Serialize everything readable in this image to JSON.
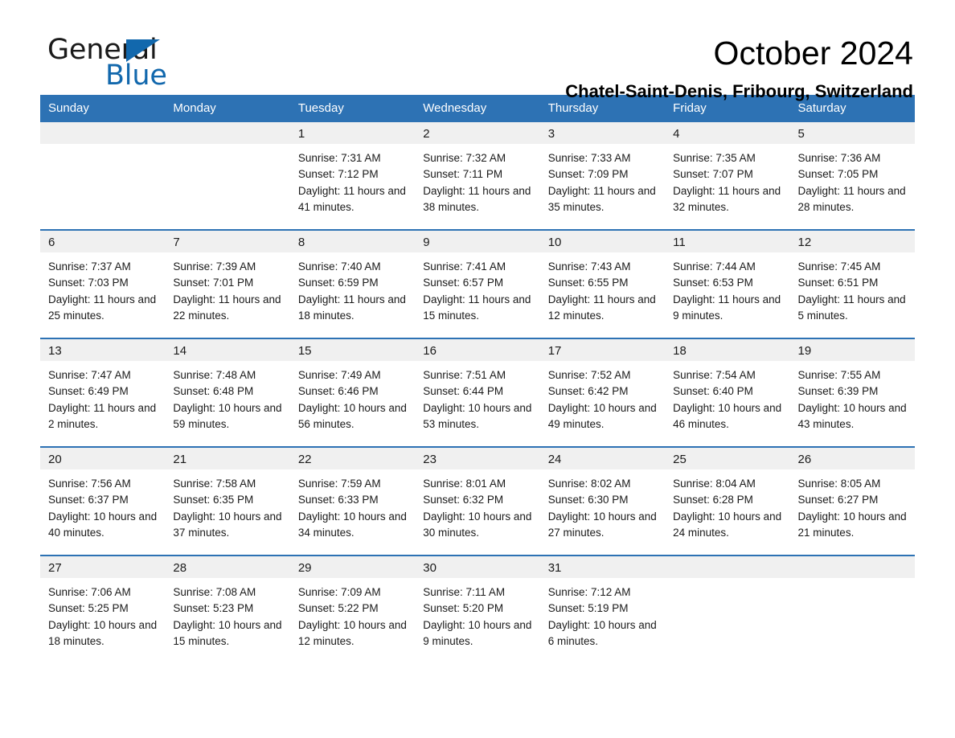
{
  "brand": {
    "name_part1": "General",
    "name_part2": "Blue",
    "triangle_color": "#1268ad",
    "text_color": "#1a1a1a"
  },
  "header": {
    "title": "October 2024",
    "subtitle": "Chatel-Saint-Denis, Fribourg, Switzerland"
  },
  "theme": {
    "header_blue": "#2d72b4",
    "daynum_band": "#f0f0f0",
    "cell_bg": "#ffffff",
    "text": "#1a1a1a"
  },
  "weekdays": [
    "Sunday",
    "Monday",
    "Tuesday",
    "Wednesday",
    "Thursday",
    "Friday",
    "Saturday"
  ],
  "labels": {
    "sunrise_prefix": "Sunrise:",
    "sunset_prefix": "Sunset:",
    "daylight_prefix": "Daylight:"
  },
  "weeks": [
    [
      {
        "day": "",
        "empty": true
      },
      {
        "day": "",
        "empty": true
      },
      {
        "day": "1",
        "sunrise": "Sunrise: 7:31 AM",
        "sunset": "Sunset: 7:12 PM",
        "daylight": "Daylight: 11 hours and 41 minutes."
      },
      {
        "day": "2",
        "sunrise": "Sunrise: 7:32 AM",
        "sunset": "Sunset: 7:11 PM",
        "daylight": "Daylight: 11 hours and 38 minutes."
      },
      {
        "day": "3",
        "sunrise": "Sunrise: 7:33 AM",
        "sunset": "Sunset: 7:09 PM",
        "daylight": "Daylight: 11 hours and 35 minutes."
      },
      {
        "day": "4",
        "sunrise": "Sunrise: 7:35 AM",
        "sunset": "Sunset: 7:07 PM",
        "daylight": "Daylight: 11 hours and 32 minutes."
      },
      {
        "day": "5",
        "sunrise": "Sunrise: 7:36 AM",
        "sunset": "Sunset: 7:05 PM",
        "daylight": "Daylight: 11 hours and 28 minutes."
      }
    ],
    [
      {
        "day": "6",
        "sunrise": "Sunrise: 7:37 AM",
        "sunset": "Sunset: 7:03 PM",
        "daylight": "Daylight: 11 hours and 25 minutes."
      },
      {
        "day": "7",
        "sunrise": "Sunrise: 7:39 AM",
        "sunset": "Sunset: 7:01 PM",
        "daylight": "Daylight: 11 hours and 22 minutes."
      },
      {
        "day": "8",
        "sunrise": "Sunrise: 7:40 AM",
        "sunset": "Sunset: 6:59 PM",
        "daylight": "Daylight: 11 hours and 18 minutes."
      },
      {
        "day": "9",
        "sunrise": "Sunrise: 7:41 AM",
        "sunset": "Sunset: 6:57 PM",
        "daylight": "Daylight: 11 hours and 15 minutes."
      },
      {
        "day": "10",
        "sunrise": "Sunrise: 7:43 AM",
        "sunset": "Sunset: 6:55 PM",
        "daylight": "Daylight: 11 hours and 12 minutes."
      },
      {
        "day": "11",
        "sunrise": "Sunrise: 7:44 AM",
        "sunset": "Sunset: 6:53 PM",
        "daylight": "Daylight: 11 hours and 9 minutes."
      },
      {
        "day": "12",
        "sunrise": "Sunrise: 7:45 AM",
        "sunset": "Sunset: 6:51 PM",
        "daylight": "Daylight: 11 hours and 5 minutes."
      }
    ],
    [
      {
        "day": "13",
        "sunrise": "Sunrise: 7:47 AM",
        "sunset": "Sunset: 6:49 PM",
        "daylight": "Daylight: 11 hours and 2 minutes."
      },
      {
        "day": "14",
        "sunrise": "Sunrise: 7:48 AM",
        "sunset": "Sunset: 6:48 PM",
        "daylight": "Daylight: 10 hours and 59 minutes."
      },
      {
        "day": "15",
        "sunrise": "Sunrise: 7:49 AM",
        "sunset": "Sunset: 6:46 PM",
        "daylight": "Daylight: 10 hours and 56 minutes."
      },
      {
        "day": "16",
        "sunrise": "Sunrise: 7:51 AM",
        "sunset": "Sunset: 6:44 PM",
        "daylight": "Daylight: 10 hours and 53 minutes."
      },
      {
        "day": "17",
        "sunrise": "Sunrise: 7:52 AM",
        "sunset": "Sunset: 6:42 PM",
        "daylight": "Daylight: 10 hours and 49 minutes."
      },
      {
        "day": "18",
        "sunrise": "Sunrise: 7:54 AM",
        "sunset": "Sunset: 6:40 PM",
        "daylight": "Daylight: 10 hours and 46 minutes."
      },
      {
        "day": "19",
        "sunrise": "Sunrise: 7:55 AM",
        "sunset": "Sunset: 6:39 PM",
        "daylight": "Daylight: 10 hours and 43 minutes."
      }
    ],
    [
      {
        "day": "20",
        "sunrise": "Sunrise: 7:56 AM",
        "sunset": "Sunset: 6:37 PM",
        "daylight": "Daylight: 10 hours and 40 minutes."
      },
      {
        "day": "21",
        "sunrise": "Sunrise: 7:58 AM",
        "sunset": "Sunset: 6:35 PM",
        "daylight": "Daylight: 10 hours and 37 minutes."
      },
      {
        "day": "22",
        "sunrise": "Sunrise: 7:59 AM",
        "sunset": "Sunset: 6:33 PM",
        "daylight": "Daylight: 10 hours and 34 minutes."
      },
      {
        "day": "23",
        "sunrise": "Sunrise: 8:01 AM",
        "sunset": "Sunset: 6:32 PM",
        "daylight": "Daylight: 10 hours and 30 minutes."
      },
      {
        "day": "24",
        "sunrise": "Sunrise: 8:02 AM",
        "sunset": "Sunset: 6:30 PM",
        "daylight": "Daylight: 10 hours and 27 minutes."
      },
      {
        "day": "25",
        "sunrise": "Sunrise: 8:04 AM",
        "sunset": "Sunset: 6:28 PM",
        "daylight": "Daylight: 10 hours and 24 minutes."
      },
      {
        "day": "26",
        "sunrise": "Sunrise: 8:05 AM",
        "sunset": "Sunset: 6:27 PM",
        "daylight": "Daylight: 10 hours and 21 minutes."
      }
    ],
    [
      {
        "day": "27",
        "sunrise": "Sunrise: 7:06 AM",
        "sunset": "Sunset: 5:25 PM",
        "daylight": "Daylight: 10 hours and 18 minutes."
      },
      {
        "day": "28",
        "sunrise": "Sunrise: 7:08 AM",
        "sunset": "Sunset: 5:23 PM",
        "daylight": "Daylight: 10 hours and 15 minutes."
      },
      {
        "day": "29",
        "sunrise": "Sunrise: 7:09 AM",
        "sunset": "Sunset: 5:22 PM",
        "daylight": "Daylight: 10 hours and 12 minutes."
      },
      {
        "day": "30",
        "sunrise": "Sunrise: 7:11 AM",
        "sunset": "Sunset: 5:20 PM",
        "daylight": "Daylight: 10 hours and 9 minutes."
      },
      {
        "day": "31",
        "sunrise": "Sunrise: 7:12 AM",
        "sunset": "Sunset: 5:19 PM",
        "daylight": "Daylight: 10 hours and 6 minutes."
      },
      {
        "day": "",
        "empty": true
      },
      {
        "day": "",
        "empty": true
      }
    ]
  ]
}
